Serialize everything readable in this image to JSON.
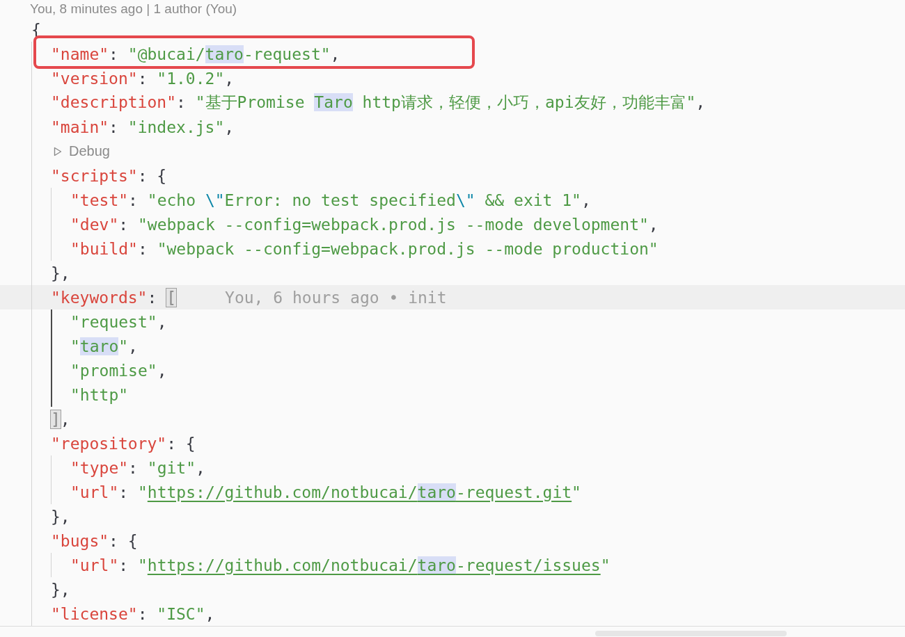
{
  "blame_header": "You, 8 minutes ago | 1 author (You)",
  "lines": [
    {
      "kind": "code",
      "tokens": [
        {
          "kind": "punct",
          "text": "{"
        }
      ],
      "children": [
        {
          "kind": "code",
          "tokens": [
            {
              "kind": "key",
              "text": "\"name\""
            },
            {
              "kind": "punct",
              "text": ": "
            },
            {
              "kind": "string",
              "text": "\"@bucai/"
            },
            {
              "kind": "match",
              "text": "taro"
            },
            {
              "kind": "string",
              "text": "-request\""
            },
            {
              "kind": "punct",
              "text": ","
            }
          ]
        },
        {
          "kind": "code",
          "tokens": [
            {
              "kind": "key",
              "text": "\"version\""
            },
            {
              "kind": "punct",
              "text": ": "
            },
            {
              "kind": "string",
              "text": "\"1.0.2\""
            },
            {
              "kind": "punct",
              "text": ","
            }
          ]
        },
        {
          "kind": "code",
          "tokens": [
            {
              "kind": "key",
              "text": "\"description\""
            },
            {
              "kind": "punct",
              "text": ": "
            },
            {
              "kind": "string",
              "text": "\"基于Promise "
            },
            {
              "kind": "match",
              "text": "Taro"
            },
            {
              "kind": "string",
              "text": " http请求，轻便，小巧，api友好，功能丰富\""
            },
            {
              "kind": "punct",
              "text": ","
            }
          ]
        },
        {
          "kind": "code",
          "tokens": [
            {
              "kind": "key",
              "text": "\"main\""
            },
            {
              "kind": "punct",
              "text": ": "
            },
            {
              "kind": "string",
              "text": "\"index.js\""
            },
            {
              "kind": "punct",
              "text": ","
            }
          ]
        },
        {
          "kind": "codelens",
          "text": "Debug"
        },
        {
          "kind": "code",
          "tokens": [
            {
              "kind": "key",
              "text": "\"scripts\""
            },
            {
              "kind": "punct",
              "text": ": {"
            }
          ],
          "children": [
            {
              "kind": "code",
              "tokens": [
                {
                  "kind": "key",
                  "text": "\"test\""
                },
                {
                  "kind": "punct",
                  "text": ": "
                },
                {
                  "kind": "string",
                  "text": "\"echo "
                },
                {
                  "kind": "escape",
                  "text": "\\\""
                },
                {
                  "kind": "string",
                  "text": "Error: no test specified"
                },
                {
                  "kind": "escape",
                  "text": "\\\""
                },
                {
                  "kind": "string",
                  "text": " && exit 1\""
                },
                {
                  "kind": "punct",
                  "text": ","
                }
              ]
            },
            {
              "kind": "code",
              "tokens": [
                {
                  "kind": "key",
                  "text": "\"dev\""
                },
                {
                  "kind": "punct",
                  "text": ": "
                },
                {
                  "kind": "string",
                  "text": "\"webpack --config=webpack.prod.js --mode development\""
                },
                {
                  "kind": "punct",
                  "text": ","
                }
              ]
            },
            {
              "kind": "code",
              "tokens": [
                {
                  "kind": "key",
                  "text": "\"build\""
                },
                {
                  "kind": "punct",
                  "text": ": "
                },
                {
                  "kind": "string",
                  "text": "\"webpack --config=webpack.prod.js --mode production\""
                }
              ]
            }
          ]
        },
        {
          "kind": "code",
          "tokens": [
            {
              "kind": "punct",
              "text": "},"
            }
          ]
        },
        {
          "kind": "current",
          "blame": "You, 6 hours ago • init",
          "tokens": [
            {
              "kind": "key",
              "text": "\"keywords\""
            },
            {
              "kind": "punct",
              "text": ": "
            },
            {
              "kind": "bracket-match",
              "text": "["
            }
          ],
          "children": [
            {
              "kind": "code",
              "tokens": [
                {
                  "kind": "string",
                  "text": "\"request\""
                },
                {
                  "kind": "punct",
                  "text": ","
                }
              ]
            },
            {
              "kind": "code",
              "tokens": [
                {
                  "kind": "string",
                  "text": "\""
                },
                {
                  "kind": "match",
                  "text": "taro"
                },
                {
                  "kind": "string",
                  "text": "\""
                },
                {
                  "kind": "punct",
                  "text": ","
                }
              ]
            },
            {
              "kind": "code",
              "tokens": [
                {
                  "kind": "string",
                  "text": "\"promise\""
                },
                {
                  "kind": "punct",
                  "text": ","
                }
              ]
            },
            {
              "kind": "code",
              "tokens": [
                {
                  "kind": "string",
                  "text": "\"http\""
                }
              ]
            }
          ]
        },
        {
          "kind": "code",
          "tokens": [
            {
              "kind": "bracket-match",
              "text": "]"
            },
            {
              "kind": "punct",
              "text": ","
            }
          ]
        },
        {
          "kind": "code",
          "tokens": [
            {
              "kind": "key",
              "text": "\"repository\""
            },
            {
              "kind": "punct",
              "text": ": {"
            }
          ],
          "children": [
            {
              "kind": "code",
              "tokens": [
                {
                  "kind": "key",
                  "text": "\"type\""
                },
                {
                  "kind": "punct",
                  "text": ": "
                },
                {
                  "kind": "string",
                  "text": "\"git\""
                },
                {
                  "kind": "punct",
                  "text": ","
                }
              ]
            },
            {
              "kind": "code",
              "tokens": [
                {
                  "kind": "key",
                  "text": "\"url\""
                },
                {
                  "kind": "punct",
                  "text": ": "
                },
                {
                  "kind": "string",
                  "text": "\""
                },
                {
                  "kind": "link",
                  "text": "https://github.com/notbucai/"
                },
                {
                  "kind": "link-match",
                  "text": "taro"
                },
                {
                  "kind": "link",
                  "text": "-request.git"
                },
                {
                  "kind": "string",
                  "text": "\""
                }
              ]
            }
          ]
        },
        {
          "kind": "code",
          "tokens": [
            {
              "kind": "punct",
              "text": "},"
            }
          ]
        },
        {
          "kind": "code",
          "tokens": [
            {
              "kind": "key",
              "text": "\"bugs\""
            },
            {
              "kind": "punct",
              "text": ": {"
            }
          ],
          "children": [
            {
              "kind": "code",
              "tokens": [
                {
                  "kind": "key",
                  "text": "\"url\""
                },
                {
                  "kind": "punct",
                  "text": ": "
                },
                {
                  "kind": "string",
                  "text": "\""
                },
                {
                  "kind": "link",
                  "text": "https://github.com/notbucai/"
                },
                {
                  "kind": "link-match",
                  "text": "taro"
                },
                {
                  "kind": "link",
                  "text": "-request/issues"
                },
                {
                  "kind": "string",
                  "text": "\""
                }
              ]
            }
          ]
        },
        {
          "kind": "code",
          "tokens": [
            {
              "kind": "punct",
              "text": "},"
            }
          ]
        },
        {
          "kind": "code",
          "tokens": [
            {
              "kind": "key",
              "text": "\"license\""
            },
            {
              "kind": "punct",
              "text": ": "
            },
            {
              "kind": "string",
              "text": "\"ISC\""
            },
            {
              "kind": "punct",
              "text": ","
            }
          ]
        }
      ]
    }
  ]
}
